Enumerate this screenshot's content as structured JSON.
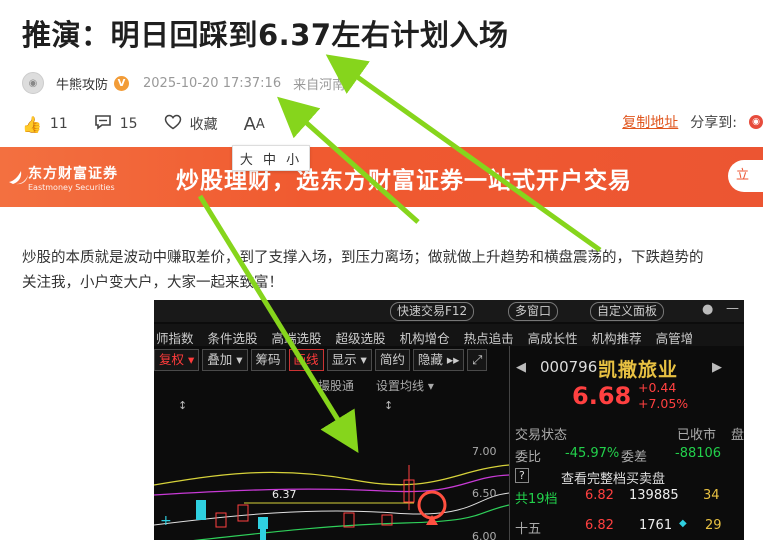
{
  "article": {
    "title": "推演：明日回踩到6.37左右计划入场",
    "author": "牛熊攻防",
    "verified_badge": "V",
    "datetime": "2025-10-20 17:37:16",
    "source": "来自河南",
    "likes": "11",
    "comments": "15",
    "favorite_label": "收藏",
    "font_size_label": "A",
    "font_size_small_label": "A",
    "copy_link_label": "复制地址",
    "share_label": "分享到:",
    "font_tooltip": "大 中 小",
    "paragraph_line1": "炒股的本质就是波动中赚取差价，到了支撑入场，到压力离场；做就做上升趋势和横盘震荡的，下跌趋势的",
    "paragraph_line2": "关注我，小户变大户，大家一起来致富！"
  },
  "banner": {
    "brand_cn": "东方财富证券",
    "brand_en": "Eastmoney Securities",
    "slogan": "炒股理财，选东方财富证券一站式开户交易",
    "button_label": "立"
  },
  "stock_screenshot": {
    "top_pills": [
      "快速交易F12",
      "多窗口",
      "自定义面板"
    ],
    "nav_items": [
      "师指数",
      "条件选股",
      "高端选股",
      "超级选股",
      "机构增仓",
      "热点追击",
      "高成长性",
      "机构推荐",
      "高管增"
    ],
    "toolbar": [
      "复权",
      "叠加",
      "筹码",
      "画线",
      "显示",
      "简约",
      "隐藏"
    ],
    "chart_sublabels": [
      "撮股通",
      "设置均线"
    ],
    "price_label_on_chart": "6.37",
    "y_ticks": [
      "7.00",
      "6.50",
      "6.00"
    ],
    "code": "000796",
    "name": "凯撒旅业",
    "price": "6.68",
    "change": "+0.44",
    "change_pct": "+7.05%",
    "rows": [
      {
        "label": "交易状态",
        "value": "已收市",
        "extra": "盘"
      },
      {
        "label": "委比",
        "value": "-45.97%",
        "label2": "委差",
        "value2": "-88106"
      },
      {
        "label": "?",
        "value": "查看完整档买卖盘"
      },
      {
        "label": "共19档",
        "value": "6.82",
        "value2": "139885",
        "value3": "34"
      },
      {
        "label": "十五",
        "value": "6.82",
        "value2": "1761",
        "value3": "29"
      }
    ]
  },
  "colors": {
    "accent": "#e0561e",
    "banner": "#ef5a31",
    "arrow": "#86d51c"
  }
}
